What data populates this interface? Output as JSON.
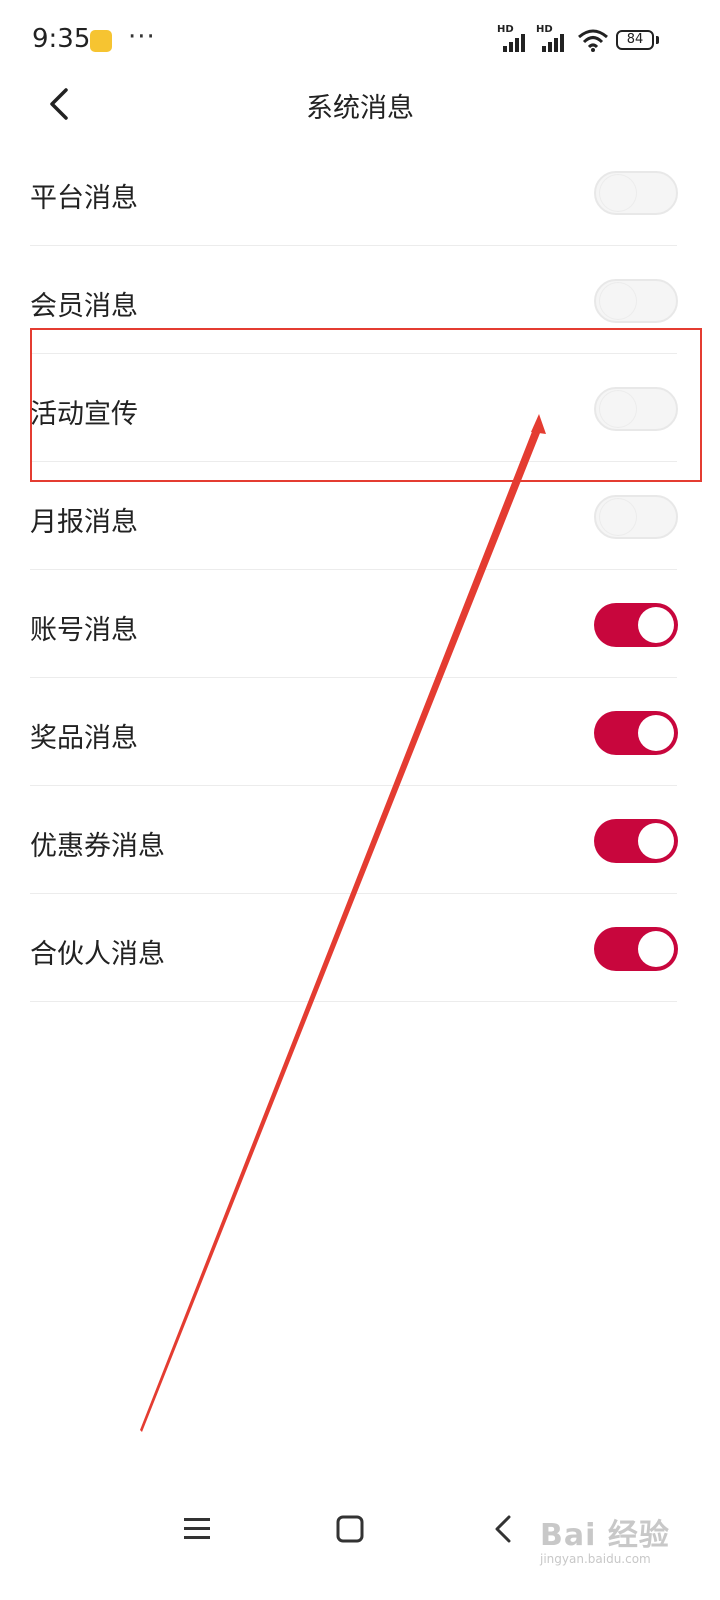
{
  "status_bar": {
    "time": "9:35",
    "more": "···",
    "battery": "84",
    "signal_label": "HD"
  },
  "header": {
    "title": "系统消息"
  },
  "settings": [
    {
      "label": "平台消息",
      "enabled": false
    },
    {
      "label": "会员消息",
      "enabled": false
    },
    {
      "label": "活动宣传",
      "enabled": false
    },
    {
      "label": "月报消息",
      "enabled": false
    },
    {
      "label": "账号消息",
      "enabled": true
    },
    {
      "label": "奖品消息",
      "enabled": true
    },
    {
      "label": "优惠券消息",
      "enabled": true
    },
    {
      "label": "合伙人消息",
      "enabled": true
    }
  ],
  "colors": {
    "toggle_on": "#c8063d",
    "toggle_off": "#f5f5f5",
    "annotation": "#e43c31"
  },
  "watermark": {
    "text": "Bai 经验",
    "sub": "jingyan.baidu.com"
  }
}
